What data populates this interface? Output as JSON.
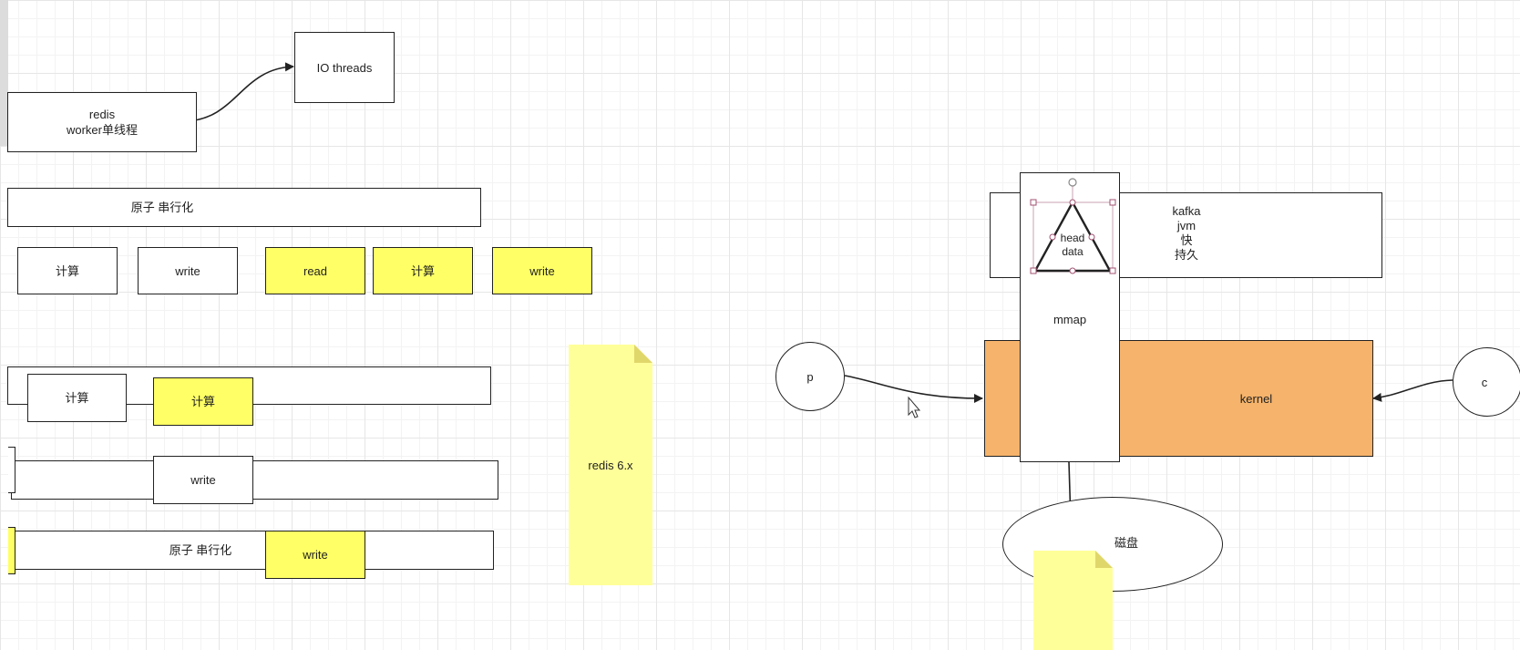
{
  "top": {
    "redis_worker": [
      "redis",
      "worker单线程"
    ],
    "io_threads": "IO threads"
  },
  "row1": {
    "label": "原子   串行化"
  },
  "row2": {
    "items": [
      "计算",
      "write",
      "read",
      "计算",
      "write"
    ]
  },
  "row3": {
    "items": [
      "计算",
      "计算"
    ]
  },
  "row4": {
    "write": "write"
  },
  "row5": {
    "label": "原子   串行化",
    "write": "write"
  },
  "note": {
    "text": "redis  6.x"
  },
  "right": {
    "kafka_lines": [
      "kafka",
      "jvm",
      "快",
      "持久"
    ],
    "head": "head",
    "data": "data",
    "mmap": "mmap",
    "kernel": "kernel",
    "producer": "p",
    "consumer": "c",
    "disk": "磁盘"
  },
  "colors": {
    "yellow": "#ffff66",
    "orange": "#f5b36b",
    "note": "#ffff99"
  }
}
